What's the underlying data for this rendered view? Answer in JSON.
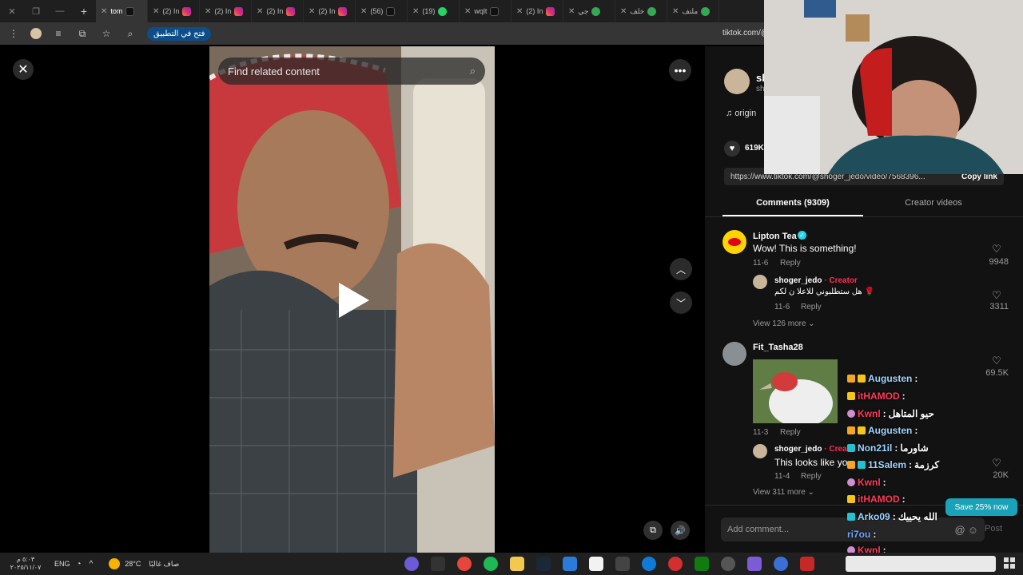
{
  "browser": {
    "tabs": [
      {
        "label": "tom",
        "icon": "tiktok-icon",
        "active": true
      },
      {
        "label": "(2) In",
        "icon": "instagram-icon"
      },
      {
        "label": "(2) In",
        "icon": "instagram-icon"
      },
      {
        "label": "(2) In",
        "icon": "instagram-icon"
      },
      {
        "label": "(2) In",
        "icon": "instagram-icon"
      },
      {
        "label": "(56)",
        "icon": "tiktok-icon"
      },
      {
        "label": "(19)",
        "icon": "whatsapp-icon"
      },
      {
        "label": "wqlt",
        "icon": "tiktok-icon"
      },
      {
        "label": "(2) In",
        "icon": "instagram-icon"
      },
      {
        "label": "جي",
        "icon": "google-icon"
      },
      {
        "label": "خلف",
        "icon": "google-icon"
      },
      {
        "label": "ملتف",
        "icon": "google-icon"
      }
    ],
    "open_in_app": "فتح في التطبيق",
    "url": "tiktok.com/@"
  },
  "video": {
    "search_placeholder": "Find related content"
  },
  "panel": {
    "author_short": "sh",
    "author_sub": "sh",
    "sound_label": "origin",
    "likes": "619K",
    "share_url": "https://www.tiktok.com/@shoger_jedo/video/7568396...",
    "copy_link": "Copy link",
    "tabs": {
      "comments": "Comments (9309)",
      "creator_videos": "Creator videos"
    },
    "comments": [
      {
        "user": "Lipton Tea",
        "text": "Wow! This is something!",
        "date": "11-6",
        "reply": "Reply",
        "likes": "9948",
        "reply_item": {
          "user": "shoger_jedo",
          "creator_tag": "· Creator",
          "text": "هل ستطلبوني للاعلا ن لكم 🌹",
          "date": "11-6",
          "reply": "Reply",
          "likes": "3311"
        },
        "view_more": "View 126 more"
      },
      {
        "user": "Fit_Tasha28",
        "date": "11-3",
        "reply": "Reply",
        "likes": "69.5K",
        "reply_item": {
          "user": "shoger_jedo",
          "creator_tag": "· Crea",
          "text": "This looks like yo",
          "date": "11-4",
          "reply": "Reply",
          "likes": "20K"
        },
        "view_more": "View 311 more"
      }
    ],
    "add_comment": "Add comment...",
    "post": "Post"
  },
  "chat": [
    {
      "name": "Augusten",
      "msg": "",
      "color": "#9fd3ff"
    },
    {
      "name": "itHAMOD",
      "msg": "",
      "color": "#ff3b5a"
    },
    {
      "name": "Kwnl",
      "msg": "حيو المتاهل",
      "color": "#ff3b5a"
    },
    {
      "name": "Augusten",
      "msg": "",
      "color": "#9fd3ff"
    },
    {
      "name": "Non21il",
      "msg": "شاورما",
      "color": "#9fd3ff"
    },
    {
      "name": "11Salem",
      "msg": "كرزمة",
      "color": "#9fd3ff"
    },
    {
      "name": "Kwnl",
      "msg": "",
      "color": "#ff3b5a"
    },
    {
      "name": "itHAMOD",
      "msg": "",
      "color": "#ff3b5a"
    },
    {
      "name": "Arko09",
      "msg": "الله يحييك",
      "color": "#9fd3ff"
    },
    {
      "name": "ri7ou",
      "msg": "",
      "color": "#6fa8ff"
    },
    {
      "name": "Kwnl",
      "msg": "",
      "color": "#ff3b5a"
    }
  ],
  "save_button": "Save 25% now",
  "taskbar": {
    "lang": "ENG",
    "weather": "28°C",
    "weather_text": "صاف غالبًا",
    "time": "٥:٠٣ م",
    "date": "٢٠٢٥/١١/٠٧"
  }
}
